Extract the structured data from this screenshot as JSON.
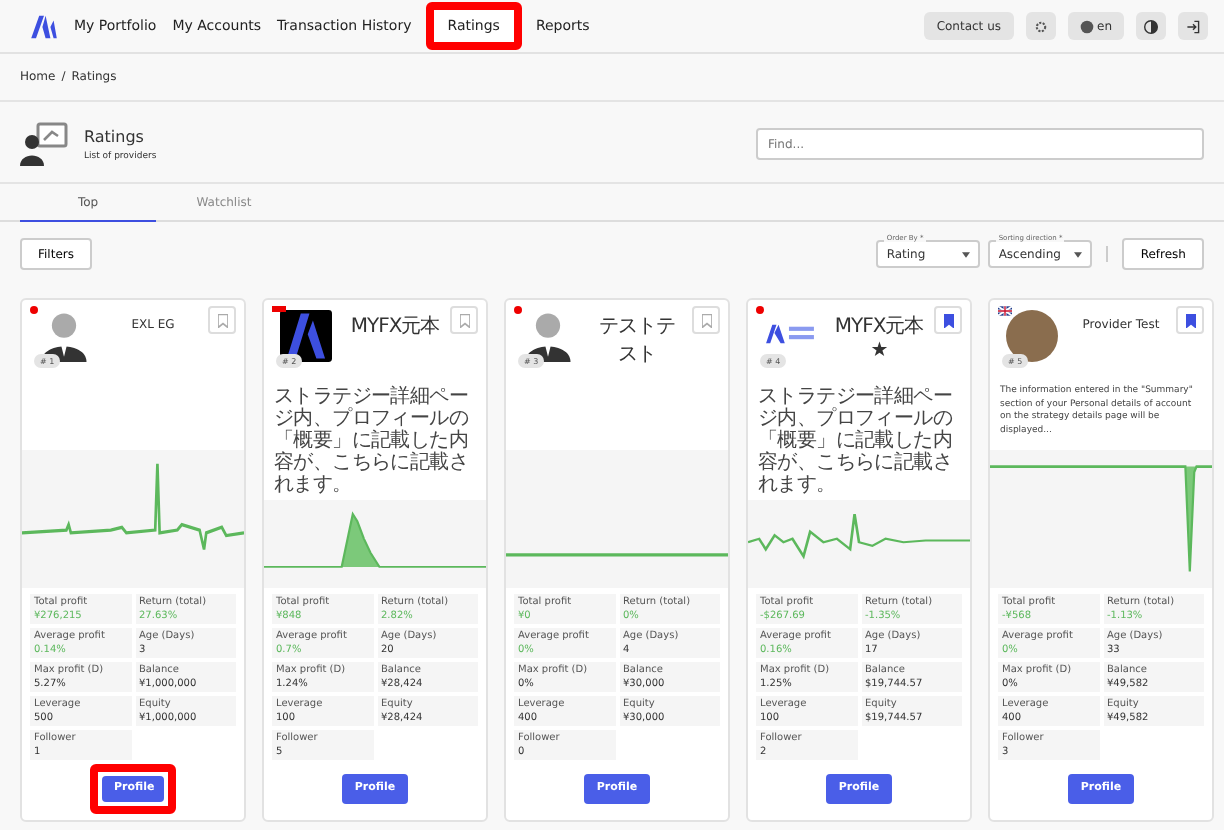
{
  "nav": {
    "items": [
      {
        "label": "My Portfolio",
        "highlighted": false
      },
      {
        "label": "My Accounts",
        "highlighted": false
      },
      {
        "label": "Transaction History",
        "highlighted": false
      },
      {
        "label": "Ratings",
        "highlighted": true
      },
      {
        "label": "Reports",
        "highlighted": false
      }
    ],
    "contact": "Contact us",
    "language": "en"
  },
  "breadcrumb": {
    "items": [
      "Home",
      "Ratings"
    ],
    "separator": "/"
  },
  "header": {
    "title": "Ratings",
    "subtitle": "List of providers",
    "search_placeholder": "Find..."
  },
  "tabs": [
    {
      "label": "Top",
      "selected": true
    },
    {
      "label": "Watchlist",
      "selected": false
    }
  ],
  "toolbar": {
    "filters": "Filters",
    "order_by": {
      "label": "Order By *",
      "value": "Rating"
    },
    "direction": {
      "label": "Sorting direction *",
      "value": "Ascending"
    },
    "refresh": "Refresh"
  },
  "cards": [
    {
      "name": "EXL EG",
      "rank": "# 1",
      "flag": {
        "kind": "dot"
      },
      "avatar": {
        "kind": "person"
      },
      "bookmarked": false,
      "chart": {
        "kind": "noisy"
      },
      "highlighted": true,
      "stats": [
        {
          "label": "Total profit",
          "value": "¥276,215",
          "positive": true
        },
        {
          "label": "Return (total)",
          "value": "27.63%",
          "positive": true
        },
        {
          "label": "Average profit",
          "value": "0.14%",
          "positive": true
        },
        {
          "label": "Age (Days)",
          "value": "3",
          "positive": false
        },
        {
          "label": "Max profit (D)",
          "value": "5.27%",
          "positive": false
        },
        {
          "label": "Balance",
          "value": "¥1,000,000",
          "positive": false
        },
        {
          "label": "Leverage",
          "value": "500",
          "positive": false
        },
        {
          "label": "Equity",
          "value": "¥1,000,000",
          "positive": false
        },
        {
          "label": "Follower",
          "value": "1",
          "positive": false
        }
      ],
      "button": "Profile"
    },
    {
      "name": "MYFX元本",
      "rank": "# 2",
      "flag": {
        "kind": "bar"
      },
      "avatar": {
        "kind": "logo"
      },
      "bookmarked": false,
      "chart": {
        "kind": "peak"
      },
      "highlighted": false,
      "description": "ストラテジー詳細ページ内、プロフィールの「概要」に記載した内容が、こちらに記載されます。",
      "stats": [
        {
          "label": "Total profit",
          "value": "¥848",
          "positive": true
        },
        {
          "label": "Return (total)",
          "value": "2.82%",
          "positive": true
        },
        {
          "label": "Average profit",
          "value": "0.7%",
          "positive": true
        },
        {
          "label": "Age (Days)",
          "value": "20",
          "positive": false
        },
        {
          "label": "Max profit (D)",
          "value": "1.24%",
          "positive": false
        },
        {
          "label": "Balance",
          "value": "¥28,424",
          "positive": false
        },
        {
          "label": "Leverage",
          "value": "100",
          "positive": false
        },
        {
          "label": "Equity",
          "value": "¥28,424",
          "positive": false
        },
        {
          "label": "Follower",
          "value": "5",
          "positive": false
        }
      ],
      "button": "Profile"
    },
    {
      "name": "テストテスト",
      "rank": "# 3",
      "flag": {
        "kind": "dot"
      },
      "avatar": {
        "kind": "person"
      },
      "bookmarked": false,
      "chart": {
        "kind": "flat"
      },
      "highlighted": false,
      "stats": [
        {
          "label": "Total profit",
          "value": "¥0",
          "positive": true
        },
        {
          "label": "Return (total)",
          "value": "0%",
          "positive": true
        },
        {
          "label": "Average profit",
          "value": "0%",
          "positive": true
        },
        {
          "label": "Age (Days)",
          "value": "4",
          "positive": false
        },
        {
          "label": "Max profit (D)",
          "value": "0%",
          "positive": false
        },
        {
          "label": "Balance",
          "value": "¥30,000",
          "positive": false
        },
        {
          "label": "Leverage",
          "value": "400",
          "positive": false
        },
        {
          "label": "Equity",
          "value": "¥30,000",
          "positive": false
        },
        {
          "label": "Follower",
          "value": "0",
          "positive": false
        }
      ],
      "button": "Profile"
    },
    {
      "name": "MYFX元本★",
      "rank": "# 4",
      "flag": {
        "kind": "dot"
      },
      "avatar": {
        "kind": "brand"
      },
      "bookmarked": true,
      "chart": {
        "kind": "wavy"
      },
      "highlighted": false,
      "description": "ストラテジー詳細ページ内、プロフィールの「概要」に記載した内容が、こちらに記載されます。",
      "stats": [
        {
          "label": "Total profit",
          "value": "-$267.69",
          "positive": true
        },
        {
          "label": "Return (total)",
          "value": "-1.35%",
          "positive": true
        },
        {
          "label": "Average profit",
          "value": "0.16%",
          "positive": true
        },
        {
          "label": "Age (Days)",
          "value": "17",
          "positive": false
        },
        {
          "label": "Max profit (D)",
          "value": "1.25%",
          "positive": false
        },
        {
          "label": "Balance",
          "value": "$19,744.57",
          "positive": false
        },
        {
          "label": "Leverage",
          "value": "100",
          "positive": false
        },
        {
          "label": "Equity",
          "value": "$19,744.57",
          "positive": false
        },
        {
          "label": "Follower",
          "value": "2",
          "positive": false
        }
      ],
      "button": "Profile"
    },
    {
      "name": "Provider Test",
      "rank": "# 5",
      "flag": {
        "kind": "uk"
      },
      "avatar": {
        "kind": "photo"
      },
      "bookmarked": true,
      "chart": {
        "kind": "dip"
      },
      "highlighted": false,
      "description": "The information entered in the \"Summary\" section of your Personal details of account on the strategy details page will be displayed...",
      "stats": [
        {
          "label": "Total profit",
          "value": "-¥568",
          "positive": true
        },
        {
          "label": "Return (total)",
          "value": "-1.13%",
          "positive": true
        },
        {
          "label": "Average profit",
          "value": "0%",
          "positive": true
        },
        {
          "label": "Age (Days)",
          "value": "33",
          "positive": false
        },
        {
          "label": "Max profit (D)",
          "value": "0%",
          "positive": false
        },
        {
          "label": "Balance",
          "value": "¥49,582",
          "positive": false
        },
        {
          "label": "Leverage",
          "value": "400",
          "positive": false
        },
        {
          "label": "Equity",
          "value": "¥49,582",
          "positive": false
        },
        {
          "label": "Follower",
          "value": "3",
          "positive": false
        }
      ],
      "button": "Profile"
    }
  ]
}
